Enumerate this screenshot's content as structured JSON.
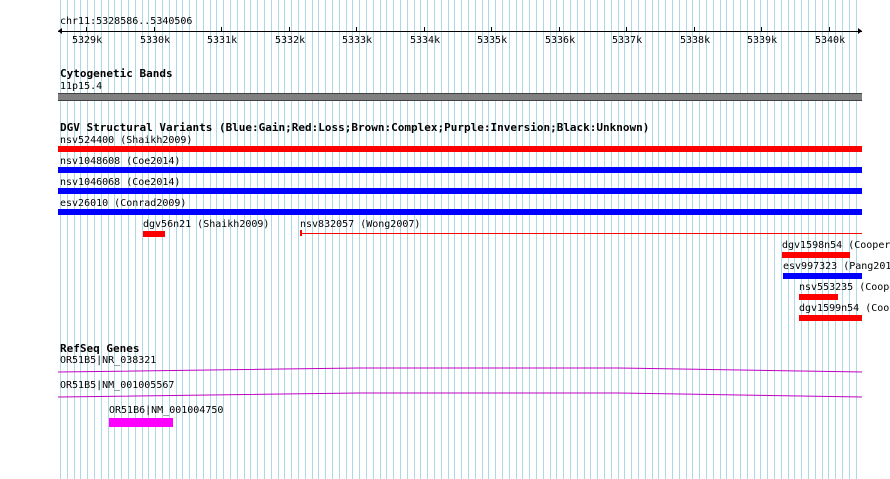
{
  "region": {
    "label": "chr11:5328586..5340506",
    "ticks": [
      "5329k",
      "5330k",
      "5331k",
      "5332k",
      "5333k",
      "5334k",
      "5335k",
      "5336k",
      "5337k",
      "5338k",
      "5339k",
      "5340k"
    ]
  },
  "cytoband": {
    "title": "Cytogenetic Bands",
    "band": "11p15.4"
  },
  "dgv": {
    "title": "DGV Structural Variants (Blue:Gain;Red:Loss;Brown:Complex;Purple:Inversion;Black:Unknown)",
    "features": [
      {
        "label": "nsv524400 (Shaikh2009)",
        "type": "loss"
      },
      {
        "label": "nsv1048608 (Coe2014)",
        "type": "gain"
      },
      {
        "label": "nsv1046068 (Coe2014)",
        "type": "gain"
      },
      {
        "label": "esv26010 (Conrad2009)",
        "type": "gain"
      },
      {
        "label": "dgv56n21 (Shaikh2009)",
        "type": "loss"
      },
      {
        "label": "nsv832057 (Wong2007)",
        "type": "loss"
      },
      {
        "label": "dgv1598n54 (Cooper",
        "type": "loss"
      },
      {
        "label": "esv997323 (Pang201",
        "type": "gain"
      },
      {
        "label": "nsv553235 (Coope",
        "type": "loss"
      },
      {
        "label": "dgv1599n54 (Coo",
        "type": "loss"
      }
    ]
  },
  "refseq": {
    "title": "RefSeq Genes",
    "genes": [
      {
        "label": "OR51B5|NR_038321"
      },
      {
        "label": "OR51B5|NM_001005567"
      },
      {
        "label": "OR51B6|NM_001004750"
      }
    ]
  },
  "colors": {
    "grid": "#add8e6",
    "loss": "#ff0000",
    "gain": "#0000ff",
    "cytoband": "#808080",
    "gene_line": "#c000c0",
    "gene_exon": "#ff00ff"
  }
}
